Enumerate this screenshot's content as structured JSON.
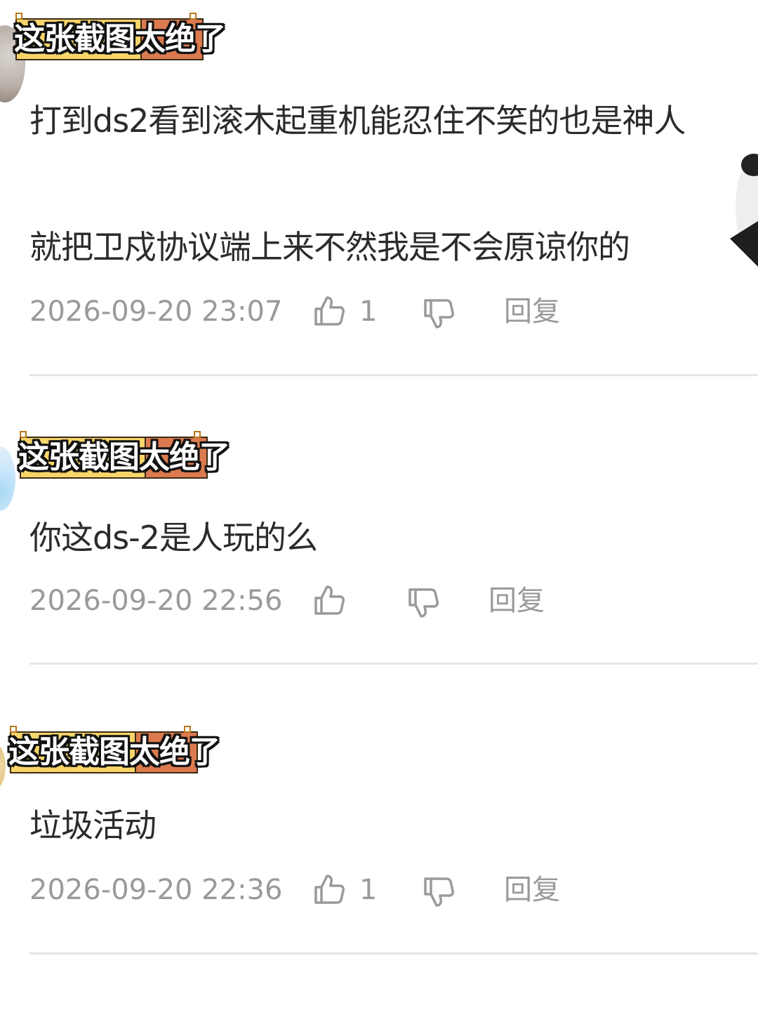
{
  "sticker_text": "这张截图太绝了",
  "comments": [
    {
      "text": "打到ds2看到滚木起重机能忍住不笑的也是神人",
      "text2": "就把卫戍协议端上来不然我是不会原谅你的",
      "time": "2026-09-20 23:07",
      "likes": "1",
      "reply_label": "回复"
    },
    {
      "text": "你这ds-2是人玩的么",
      "time": "2026-09-20 22:56",
      "likes": "",
      "reply_label": "回复"
    },
    {
      "text": "垃圾活动",
      "time": "2026-09-20 22:36",
      "likes": "1",
      "reply_label": "回复"
    }
  ],
  "colors": {
    "text": "#2b2b2b",
    "meta": "#9a9a9a",
    "divider": "#e6e6e6",
    "sticker_yellow": "#f7d56a",
    "sticker_orange": "#dc7a4f"
  }
}
